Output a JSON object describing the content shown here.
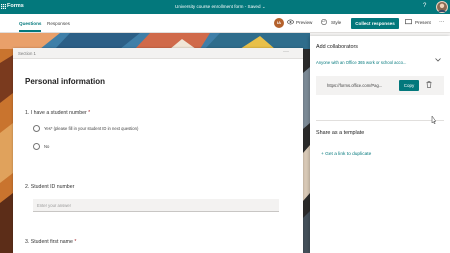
{
  "topbar": {
    "app_name": "Forms",
    "doc_title": "University course enrollment form",
    "save_status": "- Saved",
    "chevron": "⌄",
    "help_icon": "?",
    "avatar_initials": ""
  },
  "cmdbar": {
    "tabs": [
      "Questions",
      "Responses"
    ],
    "avatar_initials": "IA",
    "preview_label": "Preview",
    "style_label": "Style",
    "collect_label": "Collect responses",
    "present_label": "Present",
    "more_icon": "···"
  },
  "form": {
    "section_label": "Section 1",
    "section_more": "···",
    "title": "Personal information",
    "q1": "1. I have a student number",
    "q1_options": [
      "Yes* (please fill in your student ID in next question)",
      "No"
    ],
    "q2": "2. Student ID number",
    "q2_placeholder": "Enter your answer",
    "q3": "3. Student first name",
    "required_mark": "*"
  },
  "panel": {
    "heading": "Add collaborators",
    "dropdown": "Anyone with an Office 365 work or school acco...",
    "link": "https://forms.office.com/Pag...",
    "copy_label": "Copy",
    "share_template": "Share as a template",
    "get_link": "Get a link to duplicate",
    "plus_icon": "+"
  },
  "colors": {
    "brand": "#03787c",
    "required": "#a4262c",
    "background": "#f3f2f1"
  }
}
